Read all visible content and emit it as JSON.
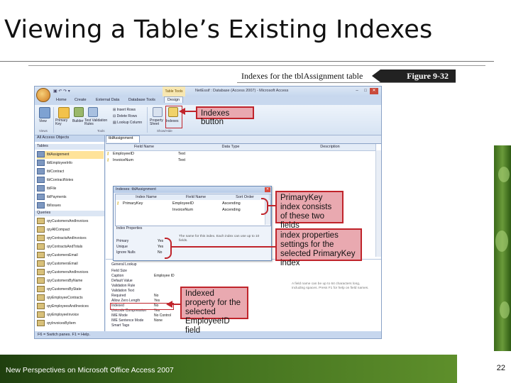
{
  "slide": {
    "title": "Viewing a Table’s Existing Indexes",
    "footer": "New Perspectives on Microsoft Office Access 2007",
    "page_number": "22"
  },
  "caption": {
    "text": "Indexes for the tblAssignment table",
    "figure": "Figure 9-32"
  },
  "window": {
    "title": "NetEssif : Database (Access 2007) - Microsoft Access",
    "context_tab": "Table Tools",
    "tabs": [
      "Home",
      "Create",
      "External Data",
      "Database Tools",
      "Design"
    ],
    "ribbon": {
      "view_label": "View",
      "primary_key_label": "Primary Key",
      "builder_label": "Builder",
      "test_validation_label": "Test Validation Rules",
      "insert_rows_label": "Insert Rows",
      "delete_rows_label": "Delete Rows",
      "lookup_column_label": "Lookup Column",
      "property_sheet_label": "Property Sheet",
      "indexes_label": "Indexes",
      "groups": [
        "Views",
        "Tools",
        "Show/Hide"
      ]
    },
    "nav": {
      "header": "All Access Objects",
      "tables_group": "Tables",
      "tables": [
        "tblAssignment",
        "tblEmployeeInfo",
        "tblContract",
        "tblContractNotes",
        "tblFile",
        "tblPayments",
        "tblIssues"
      ],
      "queries_group": "Queries",
      "queries": [
        "qryCustomersAndInvoices",
        "qryAllCompact",
        "qryContractsAndInvoices",
        "qryContractsAndTotals",
        "qryCustomersEmail",
        "qryCustomersEmail",
        "qryCustomersAndInvoices",
        "qryCustomersByName",
        "qryCustomersByState",
        "qryEmployeeContracts",
        "qryEmployeesAndInvoices",
        "qryEmployeeInvoice",
        "qryInvoicesByItem"
      ]
    },
    "doc_tab": "tblAssignment",
    "design_grid": {
      "headers": [
        "Field Name",
        "Data Type",
        "Description"
      ],
      "rows": [
        {
          "field": "EmployeeID",
          "type": "Text"
        },
        {
          "field": "InvoiceNum",
          "type": "Text"
        }
      ]
    },
    "field_props": {
      "tabs": "General  Lookup",
      "rows": [
        {
          "label": "Field Size",
          "value": ""
        },
        {
          "label": "Caption",
          "value": "Employee ID"
        },
        {
          "label": "Default Value",
          "value": ""
        },
        {
          "label": "Validation Rule",
          "value": ""
        },
        {
          "label": "Validation Text",
          "value": ""
        },
        {
          "label": "Required",
          "value": "No"
        },
        {
          "label": "Allow Zero Length",
          "value": "Yes"
        },
        {
          "label": "Indexed",
          "value": "No"
        },
        {
          "label": "Unicode Compression",
          "value": "Yes"
        },
        {
          "label": "IME Mode",
          "value": "No Control"
        },
        {
          "label": "IME Sentence Mode",
          "value": "None"
        },
        {
          "label": "Smart Tags",
          "value": ""
        }
      ],
      "help": "A field name can be up to 64 characters long, including spaces. Press F1 for help on field names."
    },
    "indexes_dialog": {
      "title": "Indexes: tblAssignment",
      "headers": [
        "Index Name",
        "Field Name",
        "Sort Order"
      ],
      "rows": [
        {
          "index": "PrimaryKey",
          "field": "EmployeeID",
          "order": "Ascending"
        },
        {
          "index": "",
          "field": "InvoiceNum",
          "order": "Ascending"
        }
      ],
      "props_header": "Index Properties",
      "props": [
        {
          "label": "Primary",
          "value": "Yes"
        },
        {
          "label": "Unique",
          "value": "Yes"
        },
        {
          "label": "Ignore Nulls",
          "value": "No"
        }
      ],
      "help": "The name for this index. Each index can use up to 10 fields."
    },
    "status": "F6 = Switch panes.  F1 = Help."
  },
  "callouts": {
    "indexes_button": "Indexes button",
    "primary_key": "PrimaryKey index consists of these two fields",
    "index_props": "index properties settings for the selected PrimaryKey index",
    "indexed_prop": "Indexed property for the selected EmployeeID field"
  }
}
